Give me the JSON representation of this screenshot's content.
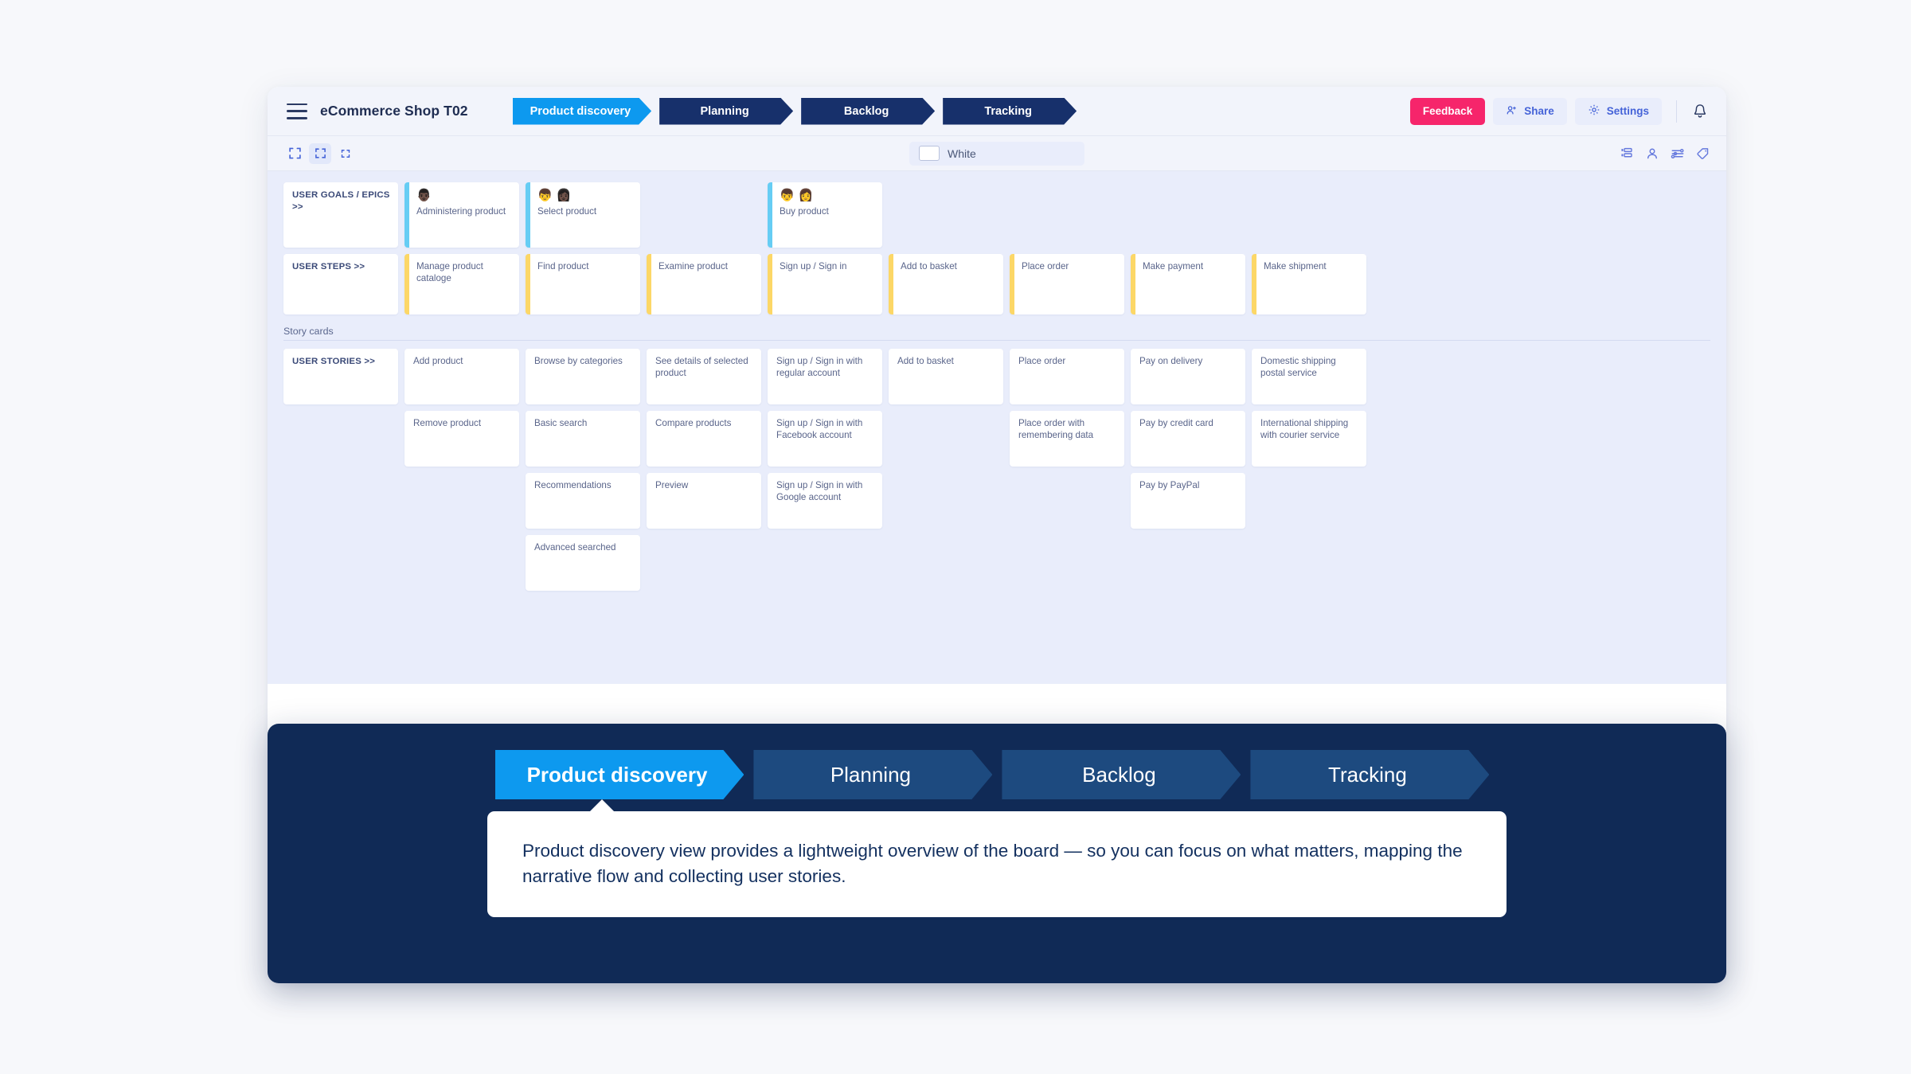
{
  "topbar": {
    "menu_icon": "hamburger-icon",
    "board_title": "eCommerce Shop T02",
    "steps": [
      {
        "label": "Product discovery",
        "active": true
      },
      {
        "label": "Planning",
        "active": false
      },
      {
        "label": "Backlog",
        "active": false
      },
      {
        "label": "Tracking",
        "active": false
      }
    ],
    "feedback_label": "Feedback",
    "share_label": "Share",
    "settings_label": "Settings",
    "notification_icon": "bell-icon"
  },
  "toolbar": {
    "zoom_icons": [
      "expand-large-icon",
      "expand-medium-icon",
      "expand-small-icon"
    ],
    "selected_zoom_index": 1,
    "color_label": "White",
    "color_hex": "#ffffff",
    "right_icons": [
      "layers-icon",
      "person-icon",
      "sliders-icon",
      "tag-icon"
    ]
  },
  "board": {
    "goals_row": {
      "header": "USER GOALS / EPICS >>",
      "cards": [
        {
          "label": "Administering product",
          "avatars": [
            "👨🏿"
          ],
          "col": 1
        },
        {
          "label": "Select product",
          "avatars": [
            "👦",
            "👩🏿"
          ],
          "col": 2
        },
        {
          "label": "",
          "avatars": [],
          "col": 3,
          "empty": true
        },
        {
          "label": "Buy product",
          "avatars": [
            "👦",
            "👩"
          ],
          "col": 4
        },
        {
          "label": "",
          "avatars": [],
          "col": 5,
          "empty": true
        },
        {
          "label": "",
          "avatars": [],
          "col": 6,
          "empty": true
        },
        {
          "label": "",
          "avatars": [],
          "col": 7,
          "empty": true
        },
        {
          "label": "",
          "avatars": [],
          "col": 8,
          "empty": true
        }
      ]
    },
    "steps_row": {
      "header": "USER STEPS >>",
      "cards": [
        "Manage product cataloge",
        "Find product",
        "Examine product",
        "Sign up / Sign in",
        "Add to basket",
        "Place order",
        "Make payment",
        "Make shipment"
      ]
    },
    "story_section_label": "Story cards",
    "stories_row": {
      "header": "USER STORIES >>",
      "columns": [
        [
          "Add product",
          "Remove product"
        ],
        [
          "Browse by categories",
          "Basic search",
          "Recommendations",
          "Advanced searched"
        ],
        [
          "See details of selected product",
          "Compare products",
          "Preview"
        ],
        [
          "Sign up / Sign in with regular account",
          "Sign up / Sign in with Facebook account",
          "Sign up / Sign in with Google account"
        ],
        [
          "Add to basket"
        ],
        [
          "Place order",
          "Place order with remembering data"
        ],
        [
          "Pay on delivery",
          "Pay by credit card",
          "Pay by PayPal"
        ],
        [
          "Domestic shipping postal service",
          "International shipping with courier service"
        ]
      ]
    }
  },
  "overlay": {
    "steps": [
      {
        "label": "Product discovery",
        "active": true
      },
      {
        "label": "Planning",
        "active": false
      },
      {
        "label": "Backlog",
        "active": false
      },
      {
        "label": "Tracking",
        "active": false
      }
    ],
    "tooltip_text": "Product discovery view provides a lightweight overview of the board — so you can focus on what matters, mapping the narrative flow and collecting user stories."
  },
  "colors": {
    "accent_blue": "#0d99ef",
    "navy": "#17306b",
    "pink": "#f6256b",
    "epic_border": "#66cdf4",
    "step_border": "#fcd767",
    "board_bg": "#e9edfb",
    "overlay_bg": "#102a56"
  }
}
